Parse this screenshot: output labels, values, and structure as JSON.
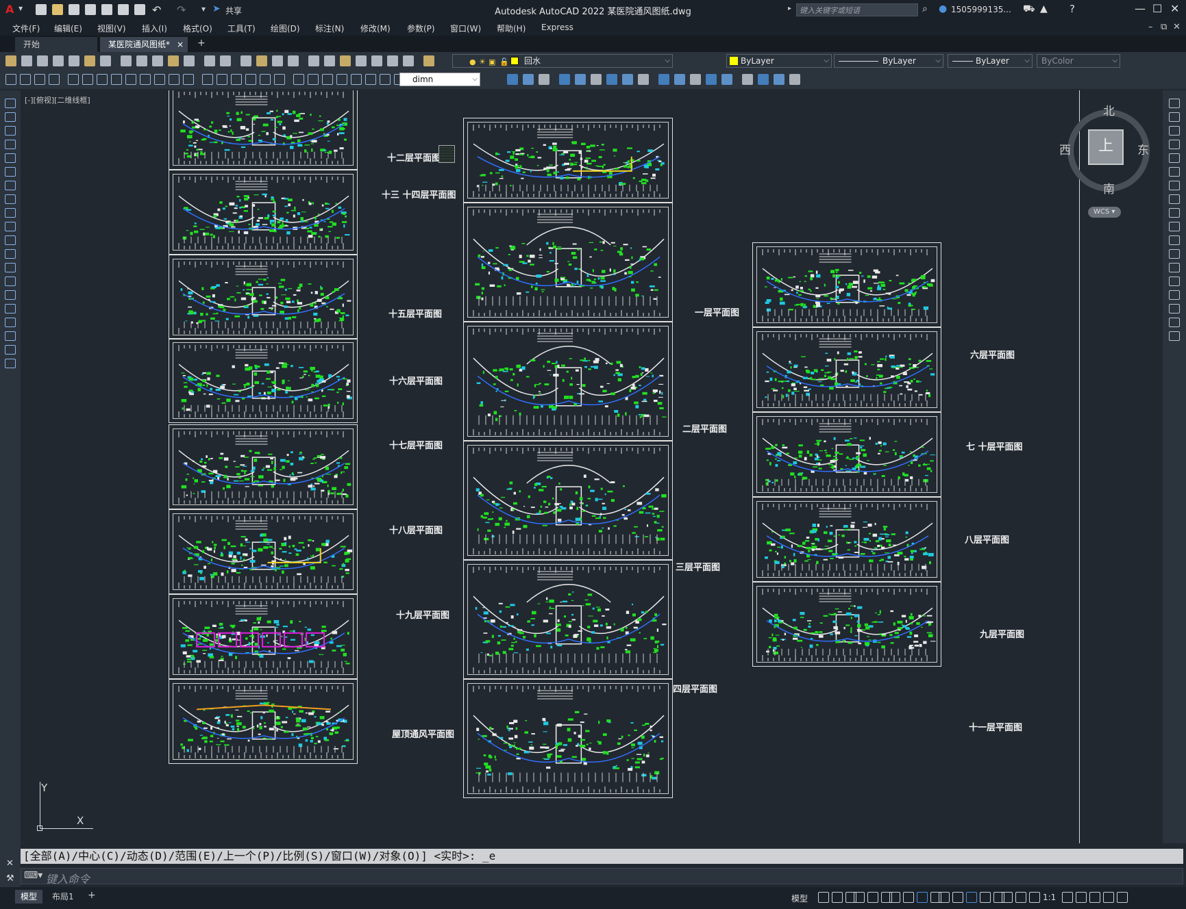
{
  "app": {
    "logo": "A",
    "title": "Autodesk AutoCAD 2022    某医院通风图纸.dwg",
    "share_label": "共享",
    "search_placeholder": "键入关键字或短语",
    "user": "1505999135...",
    "window_controls": [
      "minimize-icon",
      "restore-icon",
      "close-icon"
    ]
  },
  "menu": {
    "items": [
      "文件(F)",
      "编辑(E)",
      "视图(V)",
      "插入(I)",
      "格式(O)",
      "工具(T)",
      "绘图(D)",
      "标注(N)",
      "修改(M)",
      "参数(P)",
      "窗口(W)",
      "帮助(H)",
      "Express"
    ]
  },
  "tabs": {
    "items": [
      {
        "label": "开始",
        "active": false
      },
      {
        "label": "某医院通风图纸*",
        "active": true,
        "close": "×"
      }
    ],
    "add": "+"
  },
  "properties": {
    "layer": "回水",
    "color": "ByLayer",
    "linetype": "ByLayer",
    "lineweight": "ByLayer",
    "plotstyle": "ByColor",
    "dimstyle": "dimn",
    "layer_color": "#ffff00",
    "color_swatch": "#ffff00"
  },
  "viewport": {
    "label": "[-][俯视][二维线框]"
  },
  "viewcube": {
    "north": "北",
    "south": "南",
    "east": "东",
    "west": "西",
    "face": "上",
    "wcs": "WCS"
  },
  "ucs": {
    "y": "Y",
    "x": "X"
  },
  "plans": {
    "col1": [
      "十二层平面图",
      "十三  十四层平面图",
      "十五层平面图",
      "十六层平面图",
      "十七层平面图",
      "十八层平面图",
      "十九层平面图",
      "屋顶通风平面图"
    ],
    "col2": [
      "一层平面图",
      "二层平面图",
      "三层平面图",
      "四层平面图"
    ],
    "col3": [
      "六层平面图",
      "七  十层平面图",
      "八层平面图",
      "九层平面图",
      "十一层平面图"
    ]
  },
  "command": {
    "history": "[全部(A)/中心(C)/动态(D)/范围(E)/上一个(P)/比例(S)/窗口(W)/对象(O)] <实时>: _e",
    "placeholder": "键入命令"
  },
  "status": {
    "layouts": [
      "模型",
      "布局1"
    ],
    "add": "+",
    "model": "模型",
    "scale": "1:1"
  },
  "colors": {
    "background": "#212830",
    "panel": "#2b333d",
    "titlebar": "#1b2129",
    "accent": "#4a90d9"
  }
}
